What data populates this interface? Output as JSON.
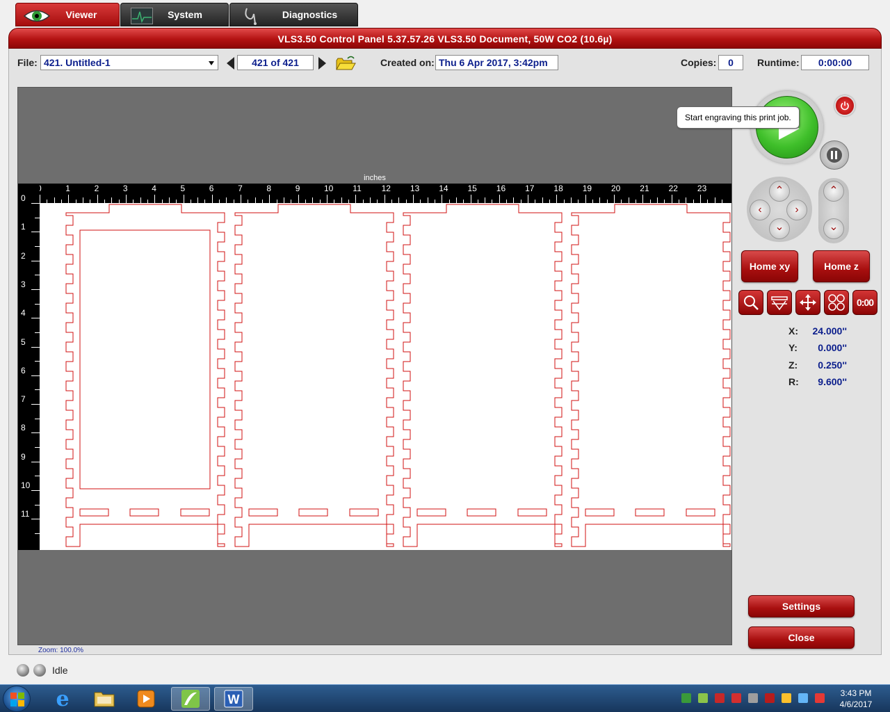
{
  "tabs": [
    {
      "label": "Viewer"
    },
    {
      "label": "System"
    },
    {
      "label": "Diagnostics"
    }
  ],
  "header": {
    "title": "VLS3.50  Control Panel   5.37.57.26     VLS3.50 Document, 50W CO2 (10.6µ)"
  },
  "file": {
    "label": "File:",
    "value": "421. Untitled-1"
  },
  "nav": {
    "counter": "421 of 421"
  },
  "created": {
    "label": "Created on:",
    "value": "Thu 6 Apr 2017,  3:42pm"
  },
  "copies": {
    "label": "Copies:",
    "value": "0"
  },
  "runtime": {
    "label": "Runtime:",
    "value": "0:00:00"
  },
  "ruler": {
    "unit": "inches",
    "top": [
      "0",
      "1",
      "2",
      "3",
      "4",
      "5",
      "6",
      "7",
      "8",
      "9",
      "10",
      "11",
      "12",
      "13",
      "14",
      "15",
      "16",
      "17",
      "18",
      "19",
      "20",
      "21",
      "22",
      "23"
    ],
    "left": [
      "0",
      "1",
      "2",
      "3",
      "4",
      "5",
      "6",
      "7",
      "8",
      "9",
      "10",
      "11"
    ]
  },
  "tooltip": "Start engraving this print job.",
  "buttons": {
    "home_xy": "Home xy",
    "home_z": "Home z",
    "settings": "Settings",
    "close": "Close"
  },
  "timer_tool": "0:00",
  "coords": [
    {
      "axis": "X:",
      "value": "24.000''"
    },
    {
      "axis": "Y:",
      "value": "0.000''"
    },
    {
      "axis": "Z:",
      "value": "0.250''"
    },
    {
      "axis": "R:",
      "value": "9.600''"
    }
  ],
  "zoom": "Zoom:  100.0%",
  "status": "Idle",
  "clock": {
    "time": "3:43 PM",
    "date": "4/6/2017"
  },
  "colors": {
    "accent": "#b31212",
    "cut_line": "#d01010",
    "value_text": "#0b1e8c"
  }
}
